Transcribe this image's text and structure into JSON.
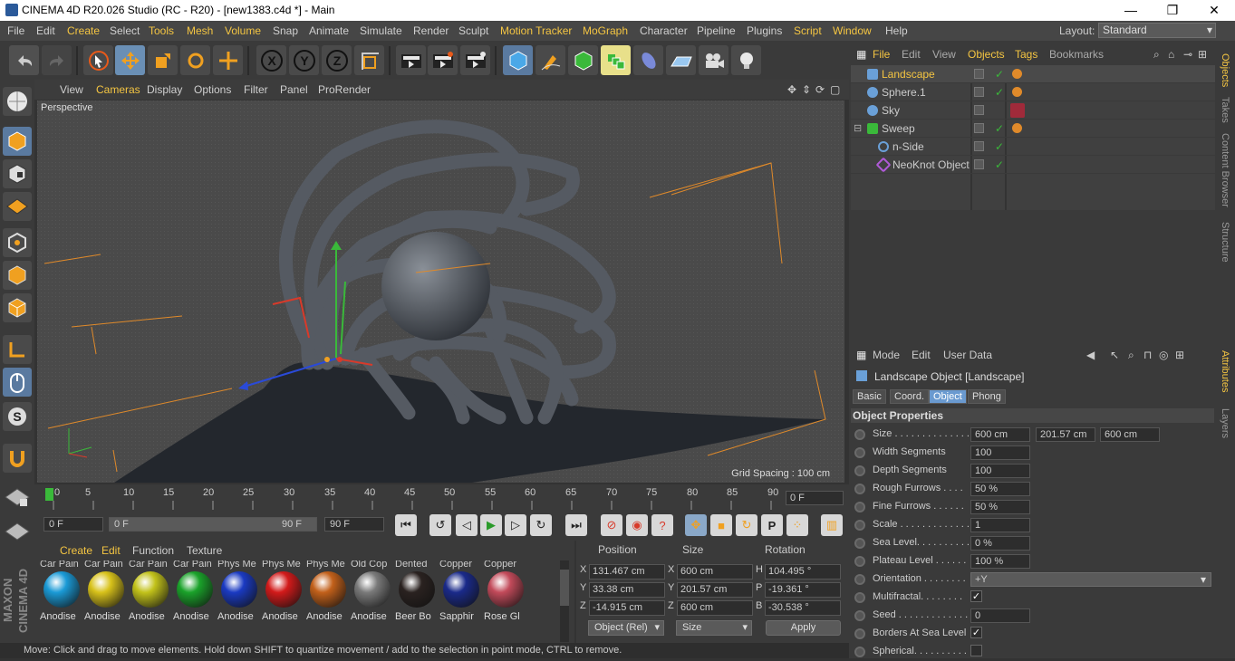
{
  "window": {
    "title": "CINEMA 4D R20.026 Studio (RC - R20) - [new1383.c4d *] - Main",
    "minimize": "—",
    "maximize": "❐",
    "close": "✕"
  },
  "menubar": {
    "items": [
      "File",
      "Edit",
      "Create",
      "Select",
      "Tools",
      "Mesh",
      "Volume",
      "Snap",
      "Animate",
      "Simulate",
      "Render",
      "Sculpt",
      "Motion Tracker",
      "MoGraph",
      "Character",
      "Pipeline",
      "Plugins",
      "Script",
      "Window",
      "Help"
    ],
    "layout_label": "Layout:",
    "layout_value": "Standard"
  },
  "toolbar": {
    "x": "X",
    "y": "Y",
    "z": "Z"
  },
  "viewport": {
    "menu": [
      "View",
      "Cameras",
      "Display",
      "Options",
      "Filter",
      "Panel",
      "ProRender"
    ],
    "label": "Perspective",
    "grid_spacing": "Grid Spacing : 100 cm"
  },
  "timeline": {
    "ticks": [
      "0",
      "5",
      "10",
      "15",
      "20",
      "25",
      "30",
      "35",
      "40",
      "45",
      "50",
      "55",
      "60",
      "65",
      "70",
      "75",
      "80",
      "85",
      "90"
    ],
    "current_frame": "0 F",
    "progress": 0.0
  },
  "playback": {
    "start": "0 F",
    "range_start": "0 F",
    "range_end": "90 F",
    "end": "90 F"
  },
  "materials": {
    "menu": [
      "Create",
      "Edit",
      "Function",
      "Texture"
    ],
    "items": [
      {
        "top": "Car Pain",
        "label": "Anodise",
        "color": "#1a9ad6"
      },
      {
        "top": "Car Pain",
        "label": "Anodise",
        "color": "#d8c21a"
      },
      {
        "top": "Car Pain",
        "label": "Anodise",
        "color": "#c2c21a"
      },
      {
        "top": "Car Pain",
        "label": "Anodise",
        "color": "#1aa22a"
      },
      {
        "top": "Phys Me",
        "label": "Anodise",
        "color": "#1a3ac2"
      },
      {
        "top": "Phys Me",
        "label": "Anodise",
        "color": "#d21a1a"
      },
      {
        "top": "Phys Me",
        "label": "Anodise",
        "color": "#c2601a"
      },
      {
        "top": "Old Cop",
        "label": "Anodise",
        "color": "#7a7a7a"
      },
      {
        "top": "Dented",
        "label": "Beer Bo",
        "color": "#2a2220"
      },
      {
        "top": "Copper",
        "label": "Sapphir",
        "color": "#1a2a8a"
      },
      {
        "top": "Copper",
        "label": "Rose Gl",
        "color": "#c24a5a"
      }
    ]
  },
  "coords": {
    "headers": [
      "Position",
      "Size",
      "Rotation"
    ],
    "rows": [
      {
        "axis": "X",
        "pos": "131.467 cm",
        "saxis": "X",
        "size": "600 cm",
        "raxis": "H",
        "rot": "104.495 °"
      },
      {
        "axis": "Y",
        "pos": "33.38 cm",
        "saxis": "Y",
        "size": "201.57 cm",
        "raxis": "P",
        "rot": "-19.361 °"
      },
      {
        "axis": "Z",
        "pos": "-14.915 cm",
        "saxis": "Z",
        "size": "600 cm",
        "raxis": "B",
        "rot": "-30.538 °"
      }
    ],
    "mode": "Object (Rel)",
    "size_mode": "Size",
    "apply": "Apply"
  },
  "status": "Move: Click and drag to move elements. Hold down SHIFT to quantize movement / add to the selection in point mode, CTRL to remove.",
  "objects": {
    "menu": [
      "File",
      "Edit",
      "View",
      "Objects",
      "Tags",
      "Bookmarks"
    ],
    "rows": [
      {
        "name": "Landscape",
        "color": "#6aa0d8"
      },
      {
        "name": "Sphere.1",
        "color": "#6aa0d8"
      },
      {
        "name": "Sky",
        "color": "#6aa0d8"
      },
      {
        "name": "Sweep",
        "color": "#3ab93a"
      },
      {
        "name": "n-Side",
        "color": "#6aa0d8"
      },
      {
        "name": "NeoKnot Object",
        "color": "#b05ad8"
      }
    ]
  },
  "side_tabs": [
    "Objects",
    "Takes",
    "Content Browser",
    "Structure",
    "Attributes",
    "Layers"
  ],
  "attributes": {
    "menu": [
      "Mode",
      "Edit",
      "User Data"
    ],
    "title": "Landscape Object [Landscape]",
    "tabs": [
      "Basic",
      "Coord.",
      "Object",
      "Phong"
    ],
    "section": "Object Properties",
    "size": [
      "600 cm",
      "201.57 cm",
      "600 cm"
    ],
    "props": [
      {
        "label": "Size . . . . . . . . . . . . . .",
        "value": ""
      },
      {
        "label": "Width Segments",
        "value": "100"
      },
      {
        "label": "Depth Segments",
        "value": "100"
      },
      {
        "label": "Rough Furrows . . . .",
        "value": "50 %"
      },
      {
        "label": "Fine Furrows . . . . . .",
        "value": "50 %"
      },
      {
        "label": "Scale . . . . . . . . . . . . .",
        "value": "1"
      },
      {
        "label": "Sea Level. . . . . . . . . .",
        "value": "0 %"
      },
      {
        "label": "Plateau Level . . . . . .",
        "value": "100 %"
      },
      {
        "label": "Orientation . . . . . . . .",
        "value": "+Y"
      },
      {
        "label": "Multifractal. . . . . . . .",
        "value": "✓"
      },
      {
        "label": "Seed . . . . . . . . . . . . .",
        "value": "0"
      },
      {
        "label": "Borders At Sea Level",
        "value": "✓"
      },
      {
        "label": "Spherical. . . . . . . . . .",
        "value": ""
      }
    ]
  }
}
